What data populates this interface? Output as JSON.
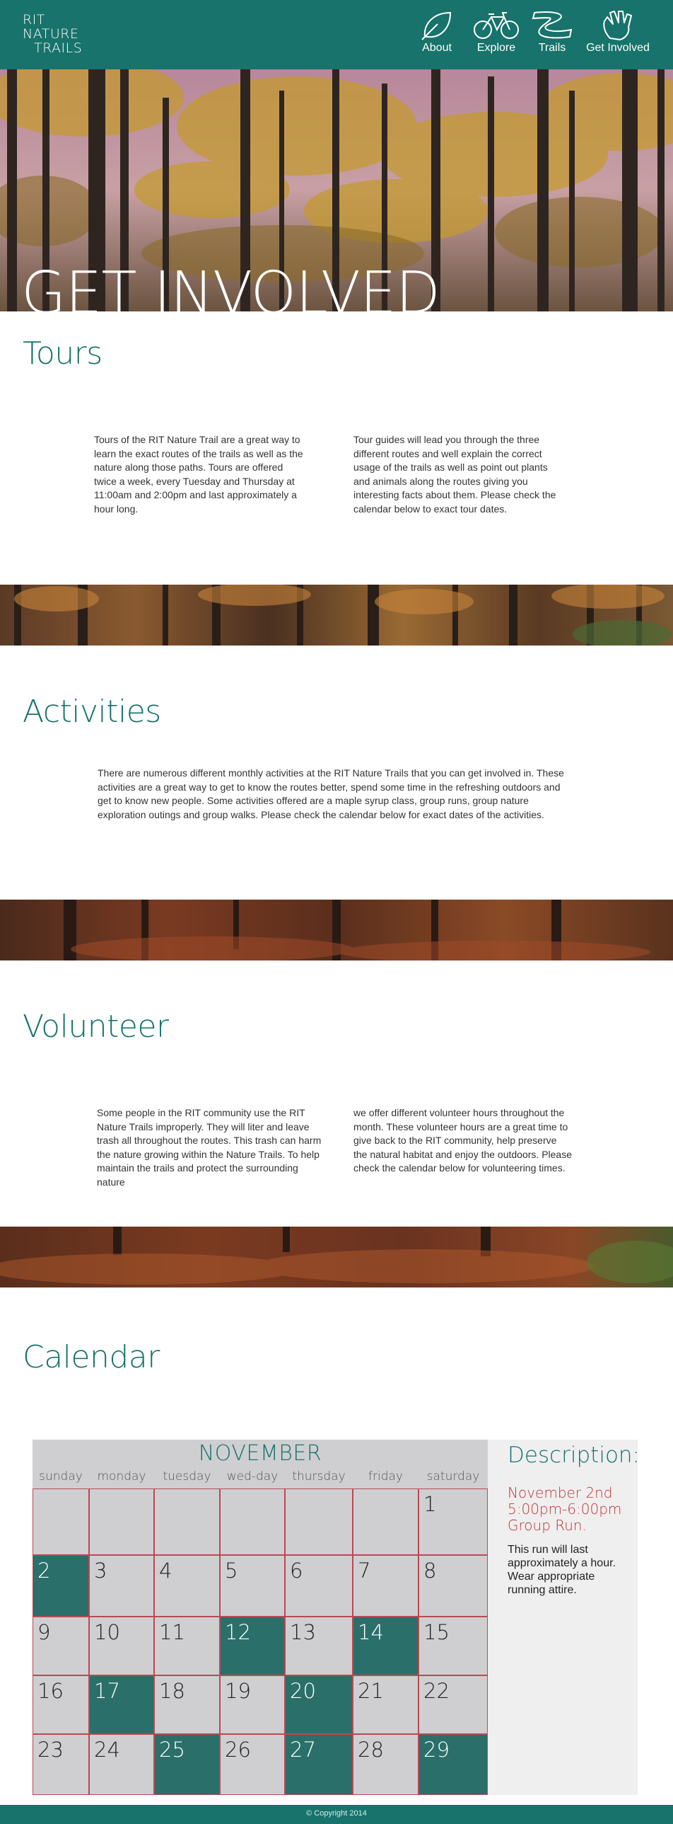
{
  "logo": {
    "line1": "RIT",
    "line2": "NATURE",
    "line3": "TRAILS"
  },
  "nav": [
    {
      "label": "About",
      "icon": "leaf-icon"
    },
    {
      "label": "Explore",
      "icon": "bicycle-icon"
    },
    {
      "label": "Trails",
      "icon": "trail-icon"
    },
    {
      "label": "Get Involved",
      "icon": "hand-icon"
    }
  ],
  "hero": {
    "title": "GET INVOLVED"
  },
  "tours": {
    "title": "Tours",
    "col1": "Tours of the RIT Nature Trail are a great way to learn the exact routes of the trails as well as the nature along those paths. Tours are offered twice a week, every Tuesday and Thursday at 11:00am and 2:00pm and last approximately a hour long.",
    "col2": "Tour guides will lead you through the three different routes and well explain the correct usage of the trails as well as point out plants and animals along the routes giving you interesting facts about them. Please check the calendar below to exact tour dates."
  },
  "activities": {
    "title": "Activities",
    "body": "There are numerous different monthly activities at the RIT Nature Trails that you can get involved in. These activities are a great way to get to know the routes better, spend some time in the refreshing outdoors and get to know new people. Some activities offered are a maple syrup class, group runs, group nature exploration outings and group walks.  Please check the calendar below for exact dates of the activities."
  },
  "volunteer": {
    "title": "Volunteer",
    "col1": "Some people in the RIT community use the RIT Nature Trails improperly. They will liter and leave trash all throughout the routes. This trash can harm the nature growing within the Nature Trails. To help maintain the trails and protect the surrounding nature",
    "col2": "we offer different volunteer hours throughout the month. These volunteer hours are a great time to give back to the RIT community, help preserve the natural habitat and enjoy the outdoors. Please check the calendar below for volunteering times."
  },
  "calendar": {
    "title": "Calendar",
    "month": "NOVEMBER",
    "weekdays": [
      "sunday",
      "monday",
      "tuesday",
      "wed-day",
      "thursday",
      "friday",
      "saturday"
    ],
    "weeks": [
      [
        "",
        "",
        "",
        "",
        "",
        "",
        "1"
      ],
      [
        "2",
        "3",
        "4",
        "5",
        "6",
        "7",
        "8"
      ],
      [
        "9",
        "10",
        "11",
        "12",
        "13",
        "14",
        "15"
      ],
      [
        "16",
        "17",
        "18",
        "19",
        "20",
        "21",
        "22"
      ],
      [
        "23",
        "24",
        "25",
        "26",
        "27",
        "28",
        "29"
      ]
    ],
    "event_days": [
      "2",
      "12",
      "14",
      "17",
      "20",
      "25",
      "27",
      "29"
    ],
    "colors": {
      "event": "#2a6f6a",
      "border": "#b84a52",
      "accent": "#17736b"
    }
  },
  "description": {
    "title": "Description:",
    "event": "November 2nd 5:00pm-6:00pm Group Run.",
    "body": "This run will last approximately a hour. Wear appropriate running attire."
  },
  "footer": {
    "copyright": "© Copyright 2014"
  }
}
